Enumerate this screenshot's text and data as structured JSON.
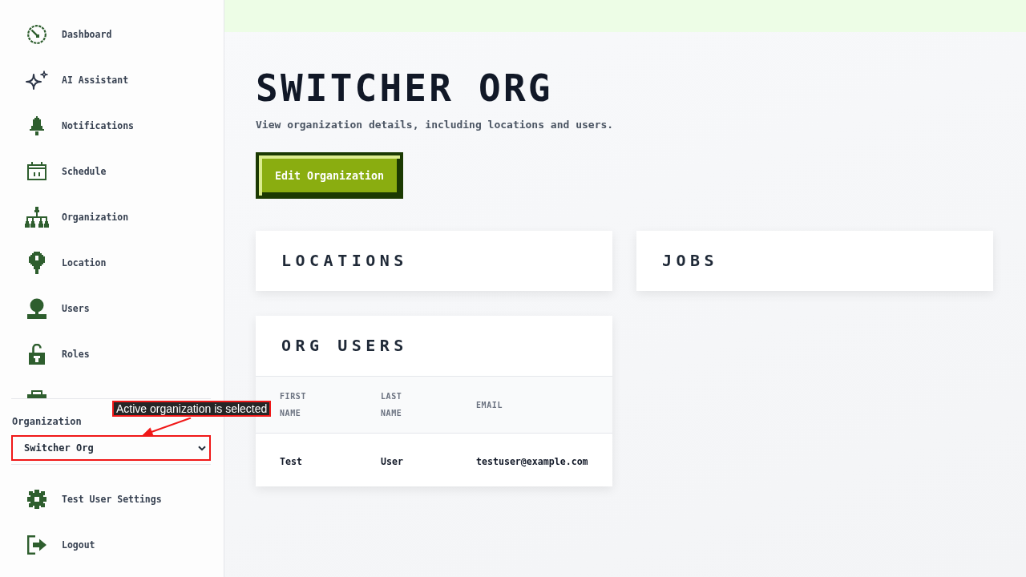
{
  "sidebar": {
    "nav_items": [
      {
        "kind": "link",
        "label": "Dashboard"
      },
      {
        "kind": "link",
        "label": "AI Assistant"
      },
      {
        "kind": "link",
        "label": "Notifications"
      },
      {
        "kind": "link",
        "label": "Schedule"
      },
      {
        "kind": "link",
        "label": "Organization"
      },
      {
        "kind": "link",
        "label": "Location"
      },
      {
        "kind": "link",
        "label": "Users"
      },
      {
        "kind": "link",
        "label": "Roles"
      },
      {
        "kind": "cut"
      }
    ],
    "organization_picker": {
      "label": "Organization",
      "value": "Switcher Org"
    },
    "account_items": [
      {
        "label": "Test User Settings"
      },
      {
        "label": "Logout"
      }
    ]
  },
  "annotation": {
    "text": "Active organization is selected"
  },
  "page": {
    "title": "SWITCHER ORG",
    "subtitle": "View organization details, including locations and users.",
    "action_button": "Edit Organization"
  },
  "cards": [
    {
      "title": "LOCATIONS"
    },
    {
      "title": "JOBS"
    },
    {
      "title": "ORG USERS",
      "table": {
        "columns": [
          "FIRST NAME",
          "LAST NAME",
          "EMAIL"
        ],
        "rows": [
          [
            "Test",
            "User",
            "testuser@example.com"
          ]
        ]
      }
    }
  ]
}
